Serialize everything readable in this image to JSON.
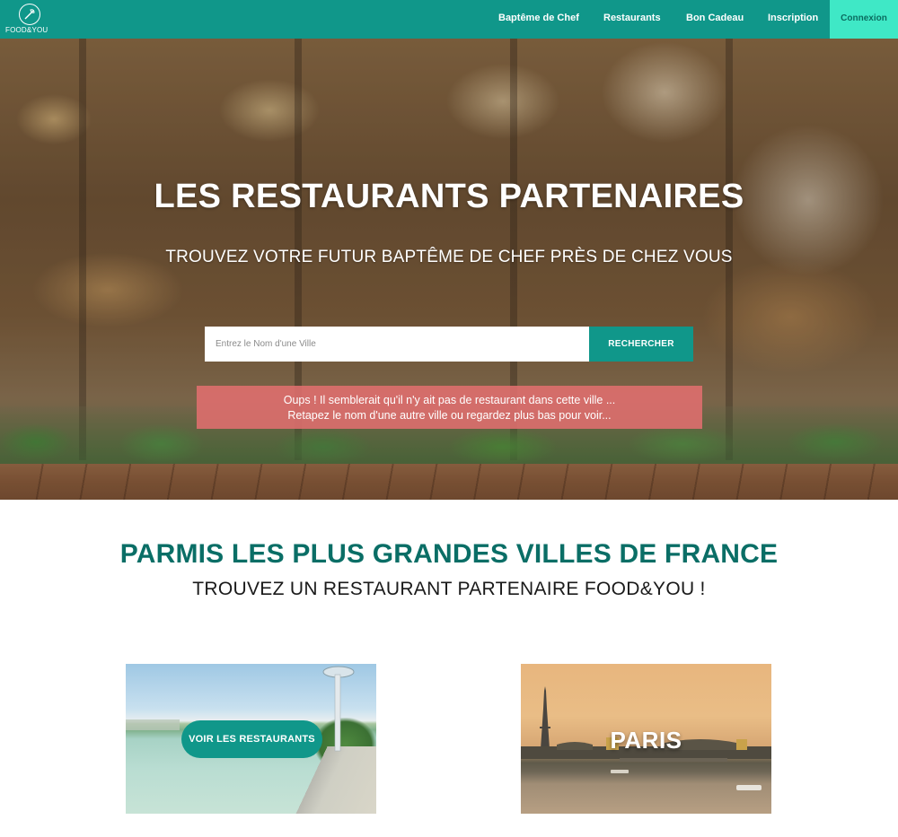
{
  "nav": {
    "logo_text": "FOOD&YOU",
    "links": [
      "Baptême de Chef",
      "Restaurants",
      "Bon Cadeau",
      "Inscription"
    ],
    "connexion": "Connexion"
  },
  "hero": {
    "title": "LES RESTAURANTS PARTENAIRES",
    "subtitle": "TROUVEZ VOTRE FUTUR BAPTÊME DE CHEF PRÈS DE CHEZ VOUS",
    "search": {
      "placeholder": "Entrez le Nom d'une Ville",
      "value": "",
      "button": "RECHERCHER"
    },
    "alert": {
      "line1": "Oups ! Il semblerait qu'il n'y ait pas de restaurant dans cette ville ...",
      "line2": "Retapez le nom d'une autre ville ou regardez plus bas pour voir..."
    }
  },
  "section": {
    "title": "PARMIS LES PLUS GRANDES VILLES DE FRANCE",
    "subtitle": "TROUVEZ UN RESTAURANT PARTENAIRE FOOD&YOU !"
  },
  "cards": [
    {
      "button": "VOIR LES RESTAURANTS"
    },
    {
      "city": "PARIS"
    }
  ],
  "colors": {
    "primary": "#10978a",
    "accent": "#3fe8c6",
    "alert": "#e06e6e",
    "section_title": "#0a6e66"
  },
  "icons": {
    "logo": "chef-whisk-logo-icon"
  }
}
